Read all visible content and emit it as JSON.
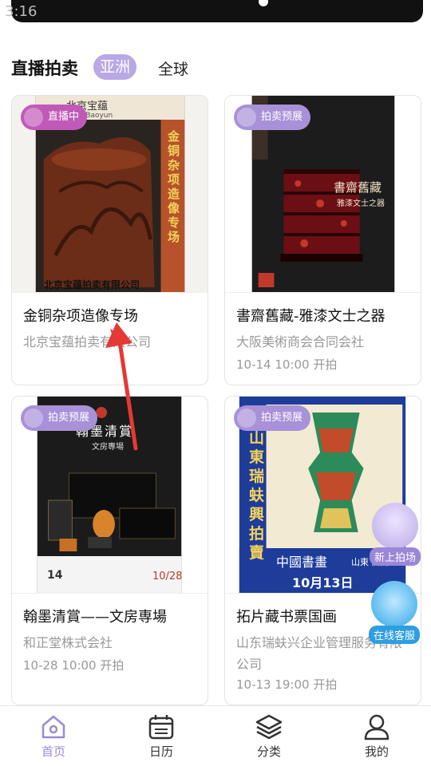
{
  "status_bar": {
    "time": "3:16"
  },
  "header": {
    "title": "直播拍卖",
    "tabs": [
      {
        "label": "亚洲",
        "active": true
      },
      {
        "label": "全球",
        "active": false
      }
    ],
    "accent": "#b9a7e6"
  },
  "cards": [
    {
      "badge": "直播中",
      "badge_type": "live",
      "name": "金铜杂项造像专场",
      "org": "北京宝蕴拍卖有限公司",
      "time": "",
      "poster": {
        "top_text": "北京宝蕴",
        "top_sub": "ng Baoyun",
        "vertical_title": "金铜杂项造像专场",
        "bottom_text": "北京宝蕴拍卖有限公司"
      }
    },
    {
      "badge": "拍卖预展",
      "badge_type": "preview",
      "name": "書齋舊藏-雅漆文士之器",
      "org": "大阪美術商会合同会社",
      "time": "10-14 10:00 开拍",
      "poster": {
        "title": "書齋舊藏",
        "subtitle": "雅漆文士之器"
      }
    },
    {
      "badge": "拍卖预展",
      "badge_type": "preview",
      "name": "翰墨清賞——文房専場",
      "org": "和正堂株式会社",
      "time": "10-28 10:00 开拍",
      "poster": {
        "title": "翰墨清賞",
        "subtitle": "文房專場",
        "date": "10/28",
        "corner": "14"
      }
    },
    {
      "badge": "拍卖预展",
      "badge_type": "preview",
      "name": "拓片藏书票国画",
      "org": "山东瑞蚨兴企业管理服务有限公司",
      "time": "10-13 19:00 开拍",
      "poster": {
        "vertical_title": "山東瑞蚨興拍賣",
        "band": "中國書畫",
        "location": "山東 濟南",
        "date": "10月13日"
      }
    }
  ],
  "floating": {
    "new_venue": "新上拍场",
    "service": "在线客服"
  },
  "bottom_nav": [
    {
      "label": "首页",
      "icon": "home-icon",
      "active": true
    },
    {
      "label": "日历",
      "icon": "calendar-icon",
      "active": false
    },
    {
      "label": "分类",
      "icon": "layers-icon",
      "active": false
    },
    {
      "label": "我的",
      "icon": "user-icon",
      "active": false
    }
  ]
}
